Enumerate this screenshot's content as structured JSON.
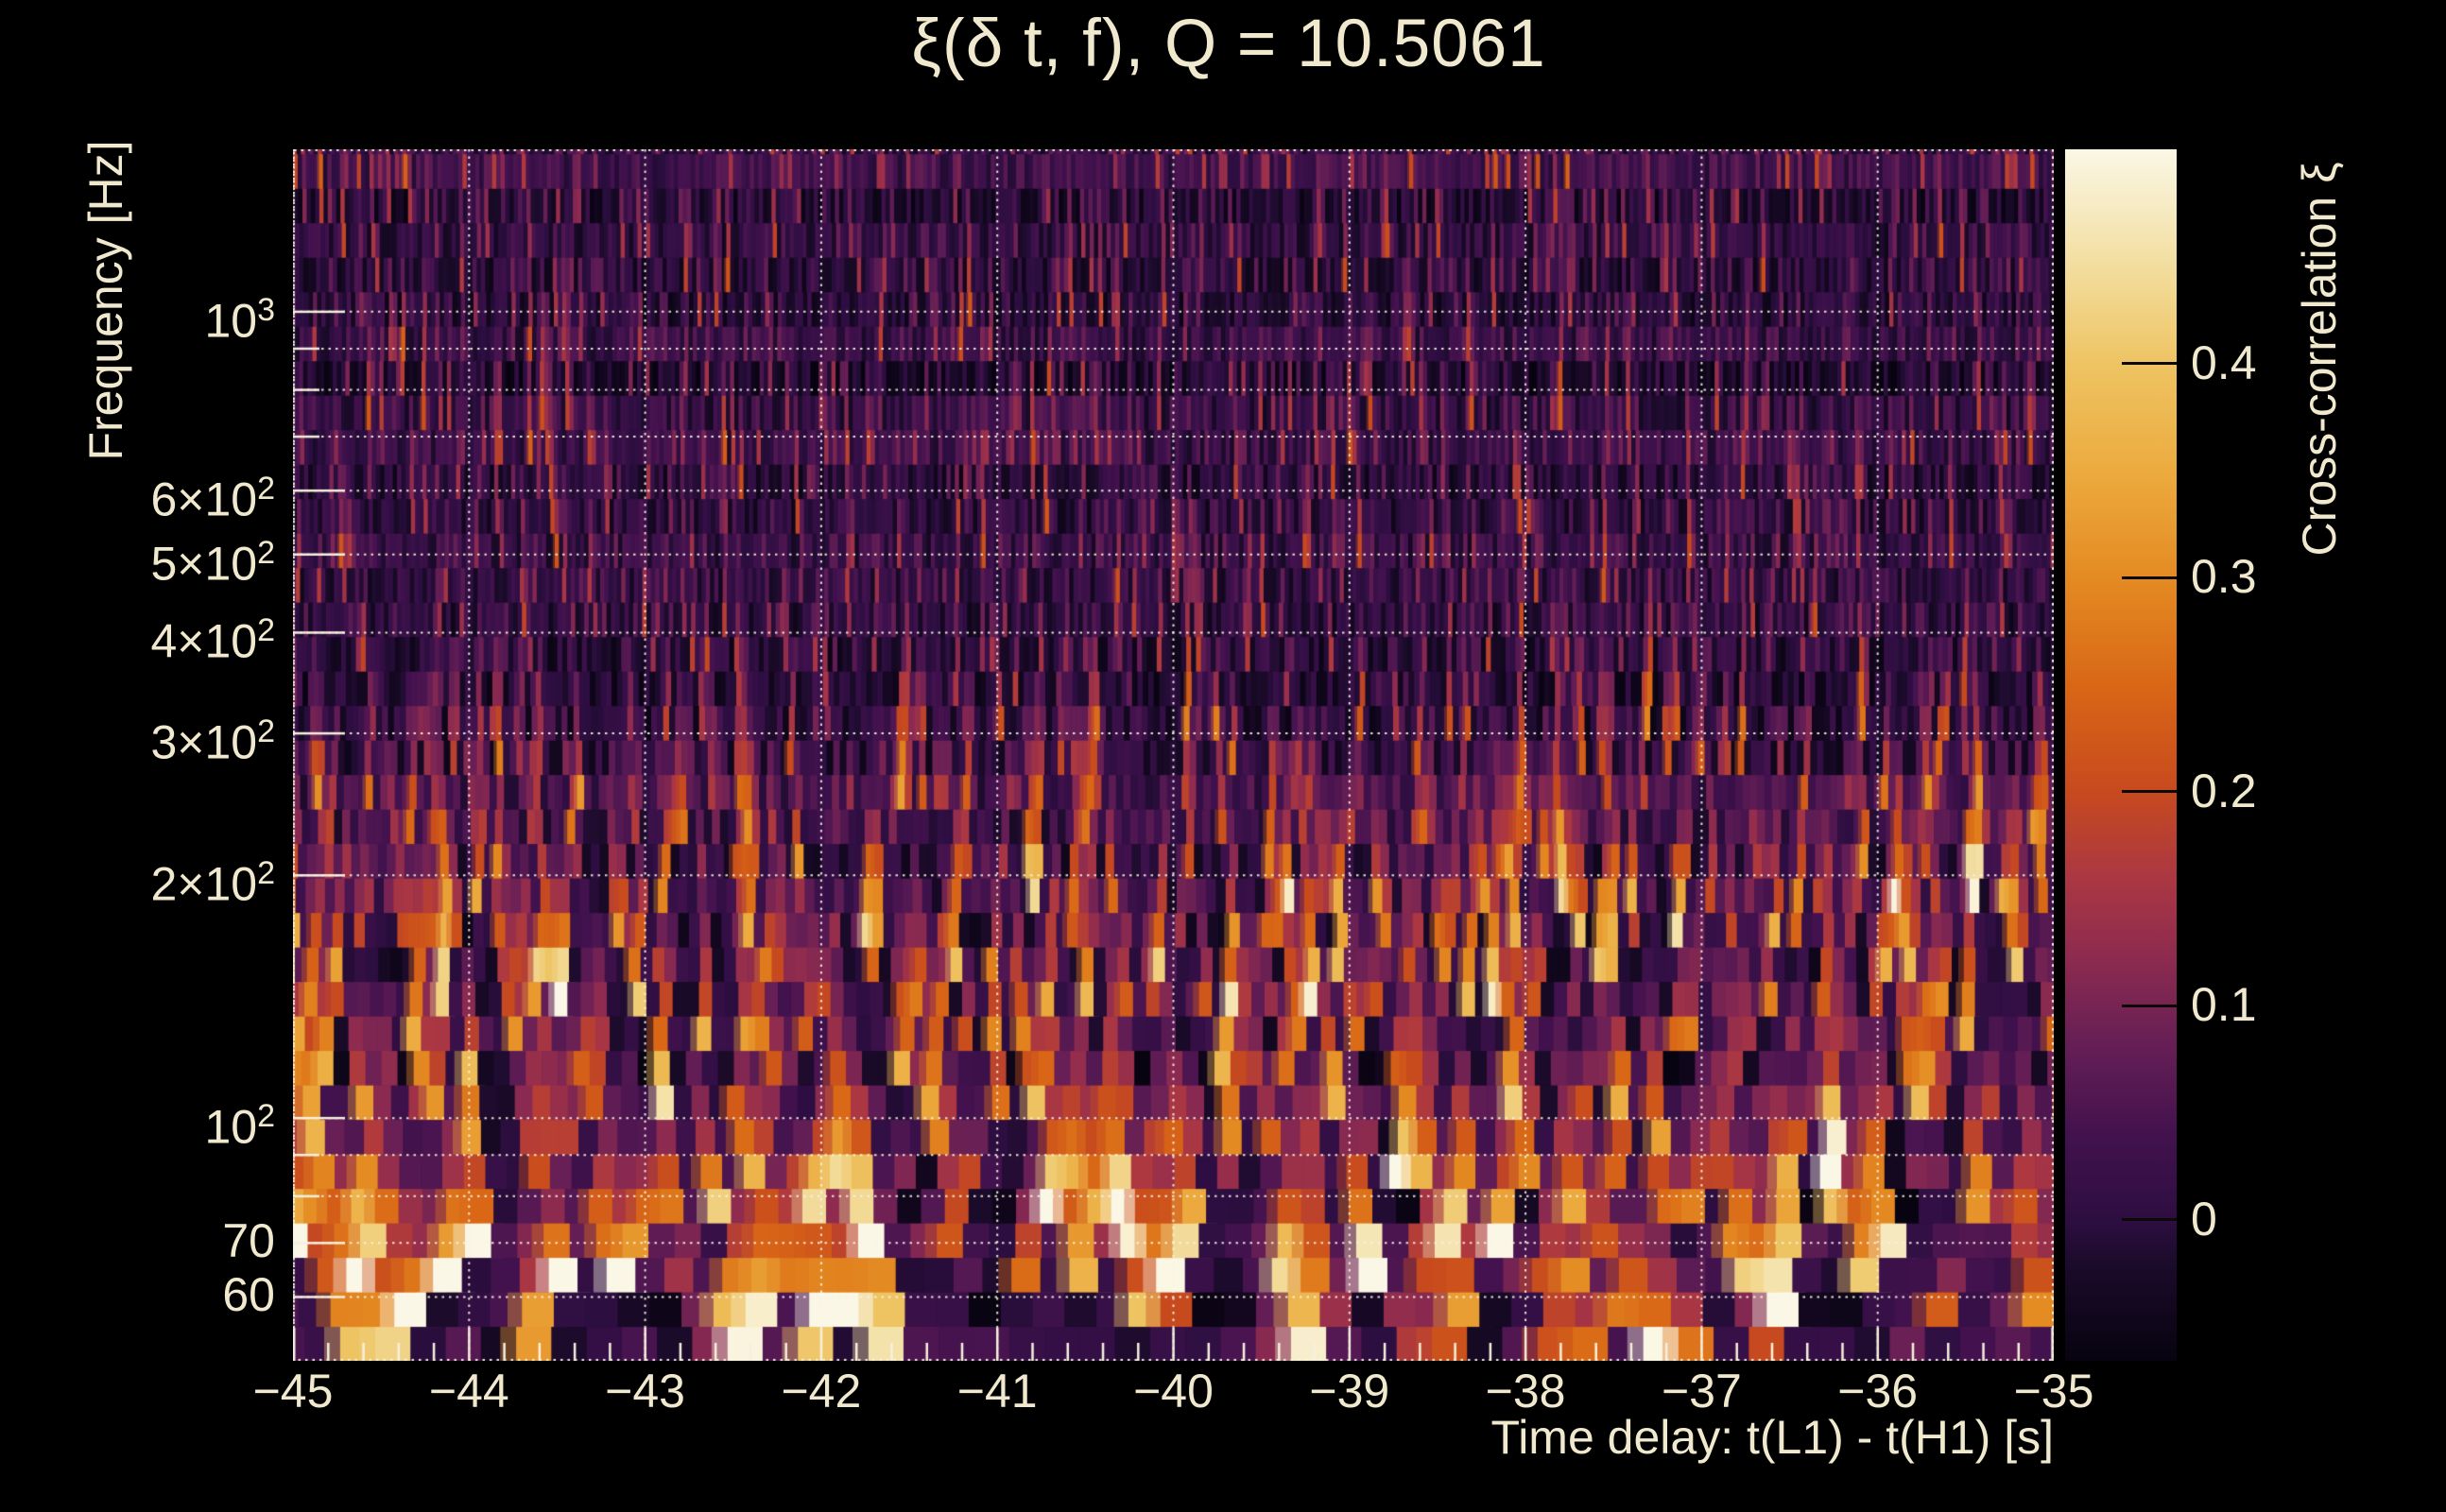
{
  "title": "ξ(δ t, f), Q = 10.5061",
  "x_axis": {
    "label": "Time delay: t(L1) - t(H1) [s]",
    "min_s": -45,
    "max_s": -35,
    "major_tick_step_s": 1,
    "minor_tick_step_s": 0.2,
    "ticks": [
      {
        "label": "−45",
        "value": -45
      },
      {
        "label": "−44",
        "value": -44
      },
      {
        "label": "−43",
        "value": -43
      },
      {
        "label": "−42",
        "value": -42
      },
      {
        "label": "−41",
        "value": -41
      },
      {
        "label": "−40",
        "value": -40
      },
      {
        "label": "−39",
        "value": -39
      },
      {
        "label": "−38",
        "value": -38
      },
      {
        "label": "−37",
        "value": -37
      },
      {
        "label": "−36",
        "value": -36
      },
      {
        "label": "−35",
        "value": -35
      }
    ]
  },
  "y_axis": {
    "label": "Frequency [Hz]",
    "scale": "log",
    "min_hz": 50,
    "max_hz": 1590,
    "gridlines_hz": [
      1000,
      900,
      800,
      700,
      600,
      500,
      400,
      300,
      200,
      100,
      90,
      80,
      70,
      60
    ],
    "ticks": [
      {
        "mantissa": "10",
        "exponent": "3",
        "hz": 1000
      },
      {
        "mantissa": "6×10",
        "exponent": "2",
        "hz": 600
      },
      {
        "mantissa": "5×10",
        "exponent": "2",
        "hz": 500
      },
      {
        "mantissa": "4×10",
        "exponent": "2",
        "hz": 400
      },
      {
        "mantissa": "3×10",
        "exponent": "2",
        "hz": 300
      },
      {
        "mantissa": "2×10",
        "exponent": "2",
        "hz": 200
      },
      {
        "mantissa": "10",
        "exponent": "2",
        "hz": 100
      },
      {
        "mantissa": "70",
        "exponent": "",
        "hz": 70
      },
      {
        "mantissa": "60",
        "exponent": "",
        "hz": 60
      }
    ]
  },
  "colorbar": {
    "label": "Cross-correlation ξ",
    "value_min": -0.066,
    "value_max": 0.5,
    "ticks": [
      {
        "label": "0.4",
        "value": 0.4
      },
      {
        "label": "0.3",
        "value": 0.3
      },
      {
        "label": "0.2",
        "value": 0.2
      },
      {
        "label": "0.1",
        "value": 0.1
      },
      {
        "label": "0",
        "value": 0
      }
    ]
  },
  "colors": {
    "background": "#000000",
    "text": "#f1e9ce",
    "grid": "#f6f0de",
    "tick": "#f6f0de",
    "colorbar_tick_line": "#0d0a06",
    "colormap_anchors": [
      {
        "v": -0.066,
        "c": "#070310"
      },
      {
        "v": -0.02,
        "c": "#1c0b2b"
      },
      {
        "v": 0.0,
        "c": "#2d0e41"
      },
      {
        "v": 0.04,
        "c": "#43124e"
      },
      {
        "v": 0.08,
        "c": "#641e55"
      },
      {
        "v": 0.12,
        "c": "#8b2a50"
      },
      {
        "v": 0.16,
        "c": "#ab3742"
      },
      {
        "v": 0.2,
        "c": "#c74a1e"
      },
      {
        "v": 0.25,
        "c": "#d96716"
      },
      {
        "v": 0.3,
        "c": "#e48b22"
      },
      {
        "v": 0.35,
        "c": "#ecab3f"
      },
      {
        "v": 0.4,
        "c": "#eec463"
      },
      {
        "v": 0.45,
        "c": "#f3e0a5"
      },
      {
        "v": 0.5,
        "c": "#fbf7e6"
      }
    ]
  },
  "chart_data": {
    "type": "heatmap",
    "title": "ξ(δ t, f), Q = 10.5061",
    "q_value": 10.5061,
    "xlabel": "Time delay: t(L1) - t(H1) [s]",
    "ylabel": "Frequency [Hz]",
    "zlabel": "Cross-correlation ξ",
    "x_range_s": [
      -45,
      -35
    ],
    "x_major_ticks_s": [
      -45,
      -44,
      -43,
      -42,
      -41,
      -40,
      -39,
      -38,
      -37,
      -36,
      -35
    ],
    "x_minor_tick_step_s": 0.2,
    "y_scale": "log",
    "y_range_hz": [
      50,
      1590
    ],
    "y_labeled_ticks_hz": [
      1000,
      600,
      500,
      400,
      300,
      200,
      100,
      70,
      60
    ],
    "y_gridlines_hz": [
      1000,
      900,
      800,
      700,
      600,
      500,
      400,
      300,
      200,
      100,
      90,
      80,
      70,
      60
    ],
    "z_range": [
      -0.066,
      0.5
    ],
    "z_ticks": [
      0,
      0.1,
      0.2,
      0.3,
      0.4
    ],
    "legend_position": "right-colorbar",
    "grid": "dotted-cream-on-majors",
    "content_summary": "Dense stochastic Q-transform tile map of cross-correlation ξ versus time delay and frequency: mostly dark purple noise tiles with sparse bright orange-to-cream vertical streaks, concentrated below ~200 Hz; tiles widen and brighten toward low frequency.",
    "tiling": {
      "seed": 1135,
      "row_freq_ratio": 1.1035,
      "tile_duration_rule_s": "Q / f_center",
      "tile_duration_min_s": 0.024,
      "tile_duration_max_s": 0.32,
      "base_noise_range": [
        -0.045,
        0.04
      ],
      "row_base_jitter": 0.03,
      "amplitude_bands": [
        {
          "below_hz": 90,
          "amp": 0.62,
          "sparsity": 5.5
        },
        {
          "below_hz": 200,
          "amp": 0.48,
          "sparsity": 7
        },
        {
          "below_hz": 330,
          "amp": 0.3,
          "sparsity": 8
        },
        {
          "below_hz": 1600,
          "amp": 0.2,
          "sparsity": 9
        }
      ],
      "vertical_streak_carry": [
        0.5,
        0.95
      ]
    }
  }
}
